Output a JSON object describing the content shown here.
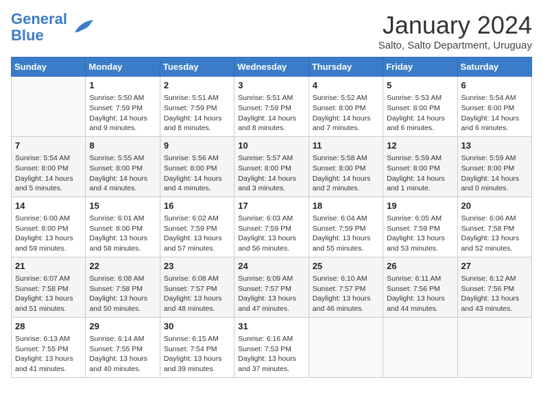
{
  "header": {
    "logo_line1": "General",
    "logo_line2": "Blue",
    "month_title": "January 2024",
    "subtitle": "Salto, Salto Department, Uruguay"
  },
  "days_of_week": [
    "Sunday",
    "Monday",
    "Tuesday",
    "Wednesday",
    "Thursday",
    "Friday",
    "Saturday"
  ],
  "weeks": [
    [
      {
        "day": null,
        "sunrise": null,
        "sunset": null,
        "daylight": null
      },
      {
        "day": "1",
        "sunrise": "Sunrise: 5:50 AM",
        "sunset": "Sunset: 7:59 PM",
        "daylight": "Daylight: 14 hours and 9 minutes."
      },
      {
        "day": "2",
        "sunrise": "Sunrise: 5:51 AM",
        "sunset": "Sunset: 7:59 PM",
        "daylight": "Daylight: 14 hours and 8 minutes."
      },
      {
        "day": "3",
        "sunrise": "Sunrise: 5:51 AM",
        "sunset": "Sunset: 7:59 PM",
        "daylight": "Daylight: 14 hours and 8 minutes."
      },
      {
        "day": "4",
        "sunrise": "Sunrise: 5:52 AM",
        "sunset": "Sunset: 8:00 PM",
        "daylight": "Daylight: 14 hours and 7 minutes."
      },
      {
        "day": "5",
        "sunrise": "Sunrise: 5:53 AM",
        "sunset": "Sunset: 8:00 PM",
        "daylight": "Daylight: 14 hours and 6 minutes."
      },
      {
        "day": "6",
        "sunrise": "Sunrise: 5:54 AM",
        "sunset": "Sunset: 8:00 PM",
        "daylight": "Daylight: 14 hours and 6 minutes."
      }
    ],
    [
      {
        "day": "7",
        "sunrise": "Sunrise: 5:54 AM",
        "sunset": "Sunset: 8:00 PM",
        "daylight": "Daylight: 14 hours and 5 minutes."
      },
      {
        "day": "8",
        "sunrise": "Sunrise: 5:55 AM",
        "sunset": "Sunset: 8:00 PM",
        "daylight": "Daylight: 14 hours and 4 minutes."
      },
      {
        "day": "9",
        "sunrise": "Sunrise: 5:56 AM",
        "sunset": "Sunset: 8:00 PM",
        "daylight": "Daylight: 14 hours and 4 minutes."
      },
      {
        "day": "10",
        "sunrise": "Sunrise: 5:57 AM",
        "sunset": "Sunset: 8:00 PM",
        "daylight": "Daylight: 14 hours and 3 minutes."
      },
      {
        "day": "11",
        "sunrise": "Sunrise: 5:58 AM",
        "sunset": "Sunset: 8:00 PM",
        "daylight": "Daylight: 14 hours and 2 minutes."
      },
      {
        "day": "12",
        "sunrise": "Sunrise: 5:59 AM",
        "sunset": "Sunset: 8:00 PM",
        "daylight": "Daylight: 14 hours and 1 minute."
      },
      {
        "day": "13",
        "sunrise": "Sunrise: 5:59 AM",
        "sunset": "Sunset: 8:00 PM",
        "daylight": "Daylight: 14 hours and 0 minutes."
      }
    ],
    [
      {
        "day": "14",
        "sunrise": "Sunrise: 6:00 AM",
        "sunset": "Sunset: 8:00 PM",
        "daylight": "Daylight: 13 hours and 59 minutes."
      },
      {
        "day": "15",
        "sunrise": "Sunrise: 6:01 AM",
        "sunset": "Sunset: 8:00 PM",
        "daylight": "Daylight: 13 hours and 58 minutes."
      },
      {
        "day": "16",
        "sunrise": "Sunrise: 6:02 AM",
        "sunset": "Sunset: 7:59 PM",
        "daylight": "Daylight: 13 hours and 57 minutes."
      },
      {
        "day": "17",
        "sunrise": "Sunrise: 6:03 AM",
        "sunset": "Sunset: 7:59 PM",
        "daylight": "Daylight: 13 hours and 56 minutes."
      },
      {
        "day": "18",
        "sunrise": "Sunrise: 6:04 AM",
        "sunset": "Sunset: 7:59 PM",
        "daylight": "Daylight: 13 hours and 55 minutes."
      },
      {
        "day": "19",
        "sunrise": "Sunrise: 6:05 AM",
        "sunset": "Sunset: 7:59 PM",
        "daylight": "Daylight: 13 hours and 53 minutes."
      },
      {
        "day": "20",
        "sunrise": "Sunrise: 6:06 AM",
        "sunset": "Sunset: 7:58 PM",
        "daylight": "Daylight: 13 hours and 52 minutes."
      }
    ],
    [
      {
        "day": "21",
        "sunrise": "Sunrise: 6:07 AM",
        "sunset": "Sunset: 7:58 PM",
        "daylight": "Daylight: 13 hours and 51 minutes."
      },
      {
        "day": "22",
        "sunrise": "Sunrise: 6:08 AM",
        "sunset": "Sunset: 7:58 PM",
        "daylight": "Daylight: 13 hours and 50 minutes."
      },
      {
        "day": "23",
        "sunrise": "Sunrise: 6:08 AM",
        "sunset": "Sunset: 7:57 PM",
        "daylight": "Daylight: 13 hours and 48 minutes."
      },
      {
        "day": "24",
        "sunrise": "Sunrise: 6:09 AM",
        "sunset": "Sunset: 7:57 PM",
        "daylight": "Daylight: 13 hours and 47 minutes."
      },
      {
        "day": "25",
        "sunrise": "Sunrise: 6:10 AM",
        "sunset": "Sunset: 7:57 PM",
        "daylight": "Daylight: 13 hours and 46 minutes."
      },
      {
        "day": "26",
        "sunrise": "Sunrise: 6:11 AM",
        "sunset": "Sunset: 7:56 PM",
        "daylight": "Daylight: 13 hours and 44 minutes."
      },
      {
        "day": "27",
        "sunrise": "Sunrise: 6:12 AM",
        "sunset": "Sunset: 7:56 PM",
        "daylight": "Daylight: 13 hours and 43 minutes."
      }
    ],
    [
      {
        "day": "28",
        "sunrise": "Sunrise: 6:13 AM",
        "sunset": "Sunset: 7:55 PM",
        "daylight": "Daylight: 13 hours and 41 minutes."
      },
      {
        "day": "29",
        "sunrise": "Sunrise: 6:14 AM",
        "sunset": "Sunset: 7:55 PM",
        "daylight": "Daylight: 13 hours and 40 minutes."
      },
      {
        "day": "30",
        "sunrise": "Sunrise: 6:15 AM",
        "sunset": "Sunset: 7:54 PM",
        "daylight": "Daylight: 13 hours and 39 minutes."
      },
      {
        "day": "31",
        "sunrise": "Sunrise: 6:16 AM",
        "sunset": "Sunset: 7:53 PM",
        "daylight": "Daylight: 13 hours and 37 minutes."
      },
      {
        "day": null,
        "sunrise": null,
        "sunset": null,
        "daylight": null
      },
      {
        "day": null,
        "sunrise": null,
        "sunset": null,
        "daylight": null
      },
      {
        "day": null,
        "sunrise": null,
        "sunset": null,
        "daylight": null
      }
    ]
  ]
}
